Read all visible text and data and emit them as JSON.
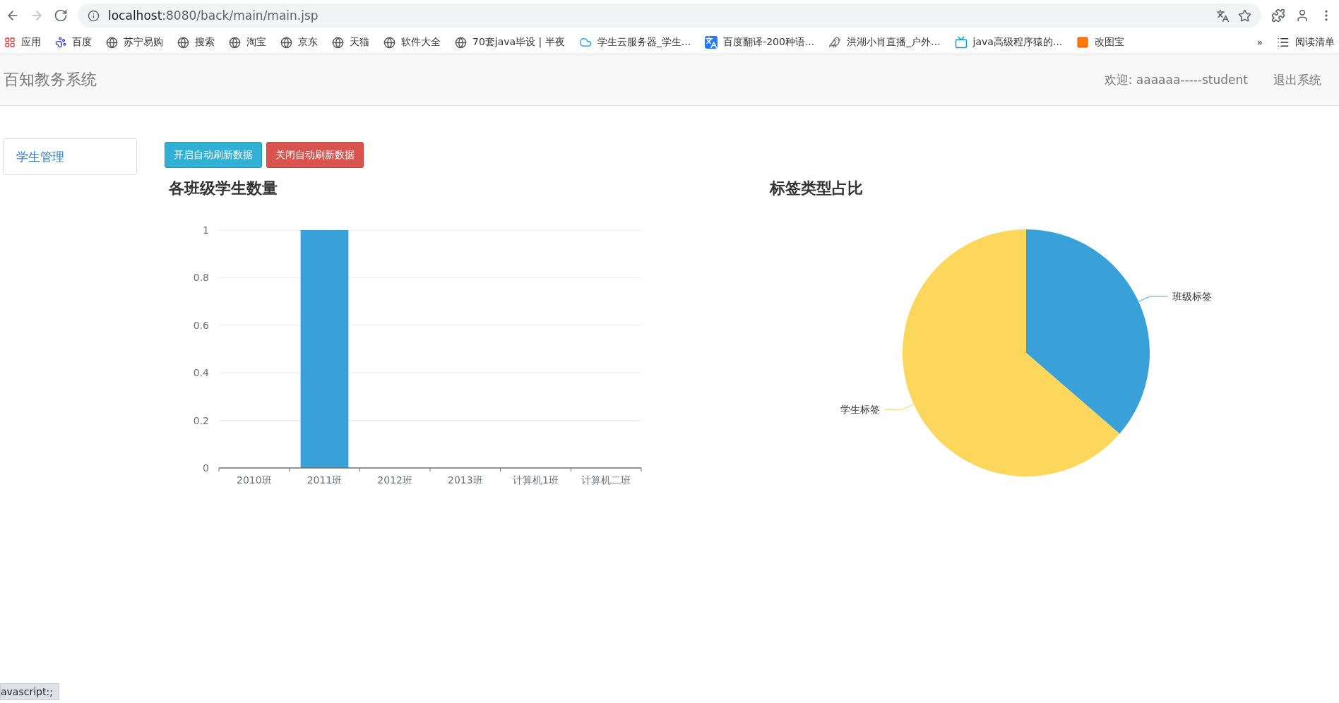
{
  "browser": {
    "url_host": "localhost",
    "url_rest": ":8080/back/main/main.jsp",
    "bookmarks": [
      "应用",
      "百度",
      "苏宁易购",
      "搜索",
      "淘宝",
      "京东",
      "天猫",
      "软件大全",
      "70套java毕设 | 半夜",
      "学生云服务器_学生...",
      "百度翻译-200种语...",
      "洪湖小肖直播_户外...",
      "java高级程序猿的...",
      "改图宝"
    ],
    "overflow": "»",
    "reading_list": "阅读清单"
  },
  "navbar": {
    "brand": "百知教务系统",
    "welcome": "欢迎: aaaaaa-----student",
    "logout": "退出系统"
  },
  "sidebar": {
    "items": [
      {
        "label": "学生管理"
      }
    ]
  },
  "buttons": [
    {
      "label": "开启自动刷新数据",
      "kind": "info"
    },
    {
      "label": "关闭自动刷新数据",
      "kind": "danger"
    }
  ],
  "bar_panel": {
    "chart_data": {
      "type": "bar",
      "title": "各班级学生数量",
      "categories": [
        "2010班",
        "2011班",
        "2012班",
        "2013班",
        "计算机1班",
        "计算机二班"
      ],
      "series": [
        {
          "color": "#3aa1d8",
          "values": [
            0,
            1,
            0,
            0,
            0,
            0
          ]
        }
      ],
      "grid": true,
      "ylim": [
        0,
        1
      ],
      "yticks": [
        0,
        {
          "value": 0.2,
          "label": "0.2"
        },
        {
          "value": 0.4,
          "label": "0.4"
        },
        {
          "value": 0.6,
          "label": "0.6"
        },
        {
          "value": 0.8,
          "label": "0.8"
        },
        1
      ]
    }
  },
  "pie_panel": {
    "title": "标签类型占比",
    "slices": [
      {
        "label": "班级标签",
        "color": "#3aa1d8"
      },
      {
        "label": "学生标签",
        "color": "#fdd65c"
      }
    ]
  },
  "status_bar": "avascript:;"
}
